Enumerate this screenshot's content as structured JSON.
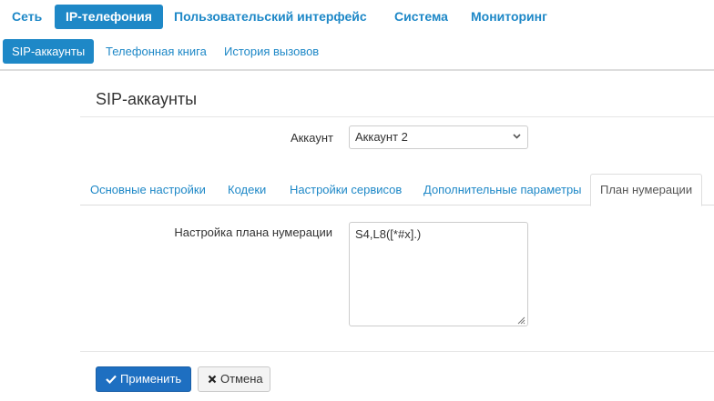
{
  "topnav": {
    "items": [
      {
        "label": "Сеть",
        "active": false
      },
      {
        "label": "IP-телефония",
        "active": true
      },
      {
        "label": "Пользовательский интерфейс",
        "active": false
      },
      {
        "label": "Система",
        "active": false
      },
      {
        "label": "Мониторинг",
        "active": false
      }
    ]
  },
  "subnav": {
    "items": [
      {
        "label": "SIP-аккаунты",
        "active": true
      },
      {
        "label": "Телефонная книга",
        "active": false
      },
      {
        "label": "История вызовов",
        "active": false
      }
    ]
  },
  "page": {
    "title": "SIP-аккаунты"
  },
  "account": {
    "label": "Аккаунт",
    "selected": "Аккаунт 2"
  },
  "tabs": [
    {
      "label": "Основные настройки",
      "active": false
    },
    {
      "label": "Кодеки",
      "active": false
    },
    {
      "label": "Настройки сервисов",
      "active": false
    },
    {
      "label": "Дополнительные параметры",
      "active": false
    },
    {
      "label": "План нумерации",
      "active": true
    }
  ],
  "dialplan": {
    "label": "Настройка плана нумерации",
    "value": "S4,L8([*#x].)"
  },
  "actions": {
    "apply_label": "Применить",
    "cancel_label": "Отмена"
  },
  "colors": {
    "accent": "#1e88c7",
    "primary_button": "#1e6fc1"
  }
}
